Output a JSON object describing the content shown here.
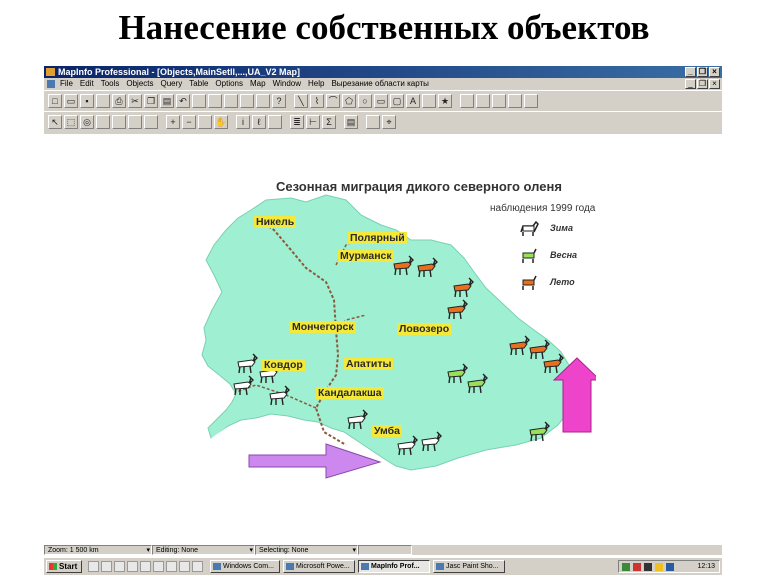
{
  "slide": {
    "title": "Нанесение собственных объектов"
  },
  "window": {
    "title": "MapInfo Professional - [Objects,MainSetll,...,UA_V2 Map]",
    "controls": {
      "minimize": "_",
      "restore": "❐",
      "close": "×"
    }
  },
  "menu": [
    "File",
    "Edit",
    "Tools",
    "Objects",
    "Query",
    "Table",
    "Options",
    "Map",
    "Window",
    "Help",
    "Вырезание области карты"
  ],
  "toolbar1": [
    "new-doc",
    "open",
    "save",
    "print-preview",
    "print",
    "cut",
    "copy",
    "paste",
    "undo",
    "new-browser",
    "new-map",
    "new-graph",
    "new-layout",
    "new-redistrict",
    "help",
    "sep",
    "line",
    "polyline",
    "arc",
    "polygon",
    "ellipse",
    "rectangle",
    "rounded-rect",
    "text",
    "frame",
    "symbol",
    "sep",
    "reshape",
    "add-node",
    "region-style",
    "line-style",
    "text-style"
  ],
  "toolbar2": [
    "select",
    "marquee",
    "radius",
    "polygon-select",
    "boundary",
    "invert",
    "graph-select",
    "sep",
    "zoom-in",
    "zoom-out",
    "change-view",
    "grabber",
    "sep",
    "info",
    "label",
    "drag-window",
    "sep",
    "layer-control",
    "ruler",
    "statistics",
    "sep",
    "legend",
    "sep",
    "hotlink",
    "snap"
  ],
  "map": {
    "title": "Сезонная миграция дикого северного оленя",
    "subtitle": "наблюдения 1999 года",
    "legend": [
      {
        "label": "Зима",
        "color": "#ffffff"
      },
      {
        "label": "Весна",
        "color": "#99e05a"
      },
      {
        "label": "Лето",
        "color": "#e8701c"
      }
    ],
    "cities": [
      "Никель",
      "Полярный",
      "Мурманск",
      "Мончегорск",
      "Ловозеро",
      "Апатиты",
      "Ковдор",
      "Кандалакша",
      "Умба"
    ],
    "land_color": "#9ff0d2",
    "arrow_purple": "#cc88ee",
    "arrow_magenta": "#ee44cc"
  },
  "status": {
    "zoom": "Zoom: 1 500 km",
    "editing": "Editing: None",
    "selecting": "Selecting: None"
  },
  "taskbar": {
    "start": "Start",
    "tasks": [
      "Windows Com...",
      "Microsoft Powe...",
      "MapInfo Prof...",
      "Jasc Paint Sho..."
    ],
    "clock": "12:13"
  }
}
